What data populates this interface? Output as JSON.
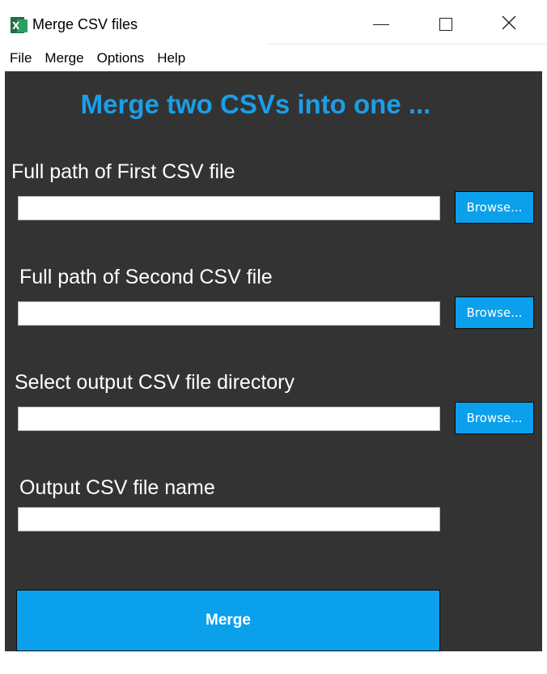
{
  "window": {
    "title": "Merge CSV files",
    "icon": "excel-icon",
    "controls": {
      "minimize": "minimize-icon",
      "maximize": "maximize-icon",
      "close": "close-icon"
    }
  },
  "menu": {
    "items": [
      "File",
      "Merge",
      "Options",
      "Help"
    ]
  },
  "main": {
    "heading": "Merge two CSVs into one ...",
    "fields": [
      {
        "label": "Full path of First CSV file",
        "value": "",
        "browse_label": "Browse..."
      },
      {
        "label": "Full path of Second CSV file",
        "value": "",
        "browse_label": "Browse..."
      },
      {
        "label": "Select output CSV file directory",
        "value": "",
        "browse_label": "Browse..."
      },
      {
        "label": "Output CSV file name",
        "value": ""
      }
    ],
    "merge_label": "Merge"
  },
  "colors": {
    "background": "#333333",
    "accent": "#0aa0ec",
    "heading": "#1a9ee8",
    "label": "#ffffff"
  }
}
